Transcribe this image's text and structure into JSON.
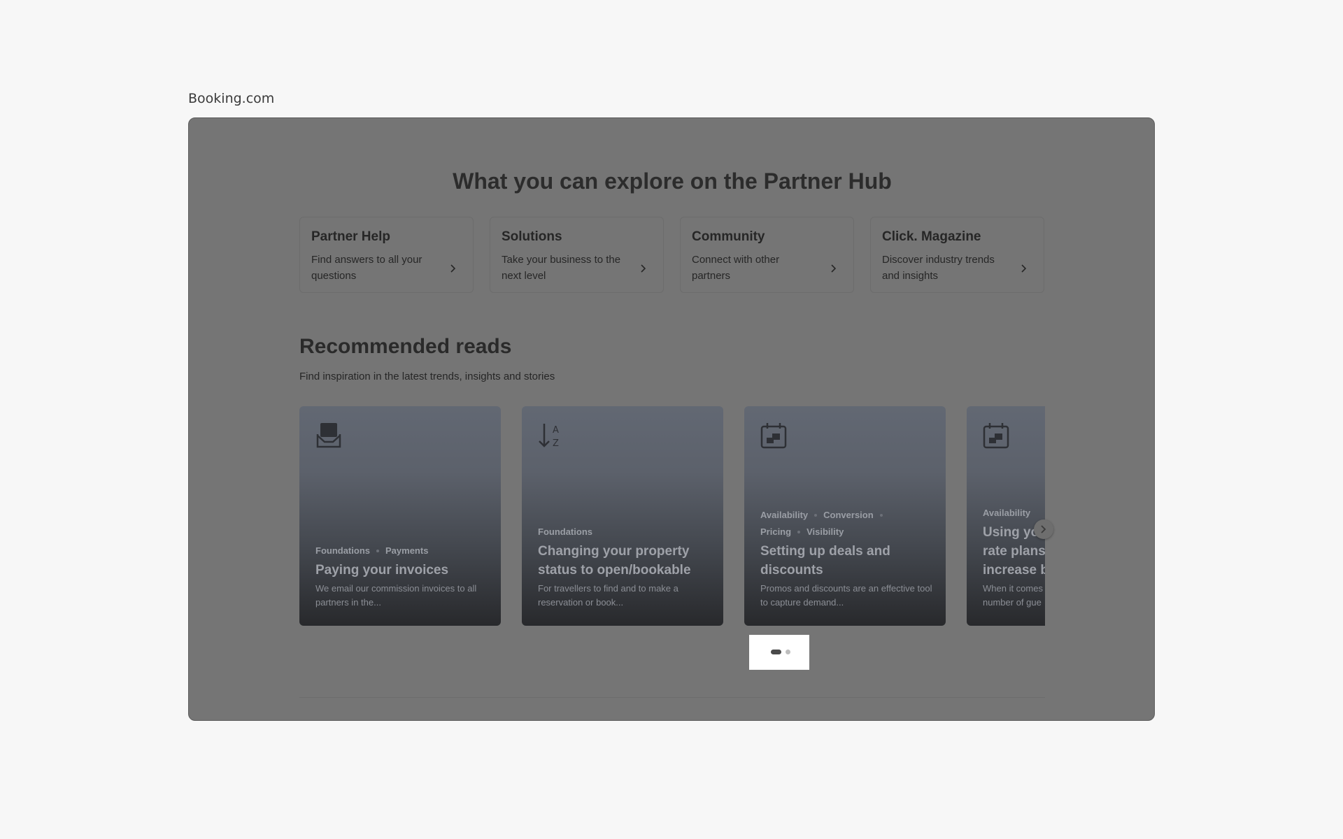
{
  "site_label": "Booking.com",
  "hub": {
    "title": "What you can explore on the Partner Hub",
    "cards": [
      {
        "title": "Partner Help",
        "desc": "Find answers to all your questions"
      },
      {
        "title": "Solutions",
        "desc": "Take your business to the next level"
      },
      {
        "title": "Community",
        "desc": "Connect with other partners"
      },
      {
        "title": "Click. Magazine",
        "desc": "Discover industry trends and insights"
      }
    ]
  },
  "reads": {
    "title": "Recommended reads",
    "subtitle": "Find inspiration in the latest trends, insights and stories",
    "cards": [
      {
        "icon": "inbox-tray-icon",
        "tags": [
          "Foundations",
          "Payments"
        ],
        "title": "Paying your invoices",
        "desc": "We email our commission invoices to all partners in the..."
      },
      {
        "icon": "sort-az-icon",
        "tags": [
          "Foundations"
        ],
        "title": "Changing your property status to open/bookable",
        "desc": "For travellers to find and to make a reservation or book..."
      },
      {
        "icon": "calendar-icon",
        "tags": [
          "Availability",
          "Conversion",
          "Pricing",
          "Visibility"
        ],
        "title": "Setting up deals and discounts",
        "desc": "Promos and discounts are an effective tool to capture demand..."
      },
      {
        "icon": "calendar-icon",
        "tags": [
          "Availability"
        ],
        "title": "Using yo rate plans increase b",
        "desc": "When it comes number of gue"
      }
    ],
    "pagination": {
      "pages": 2,
      "active": 1
    }
  },
  "colors": {
    "overlay": "#757575",
    "page_bg": "#f7f7f7",
    "card_gradient_top": "#626873",
    "card_gradient_bottom": "#28292c"
  }
}
